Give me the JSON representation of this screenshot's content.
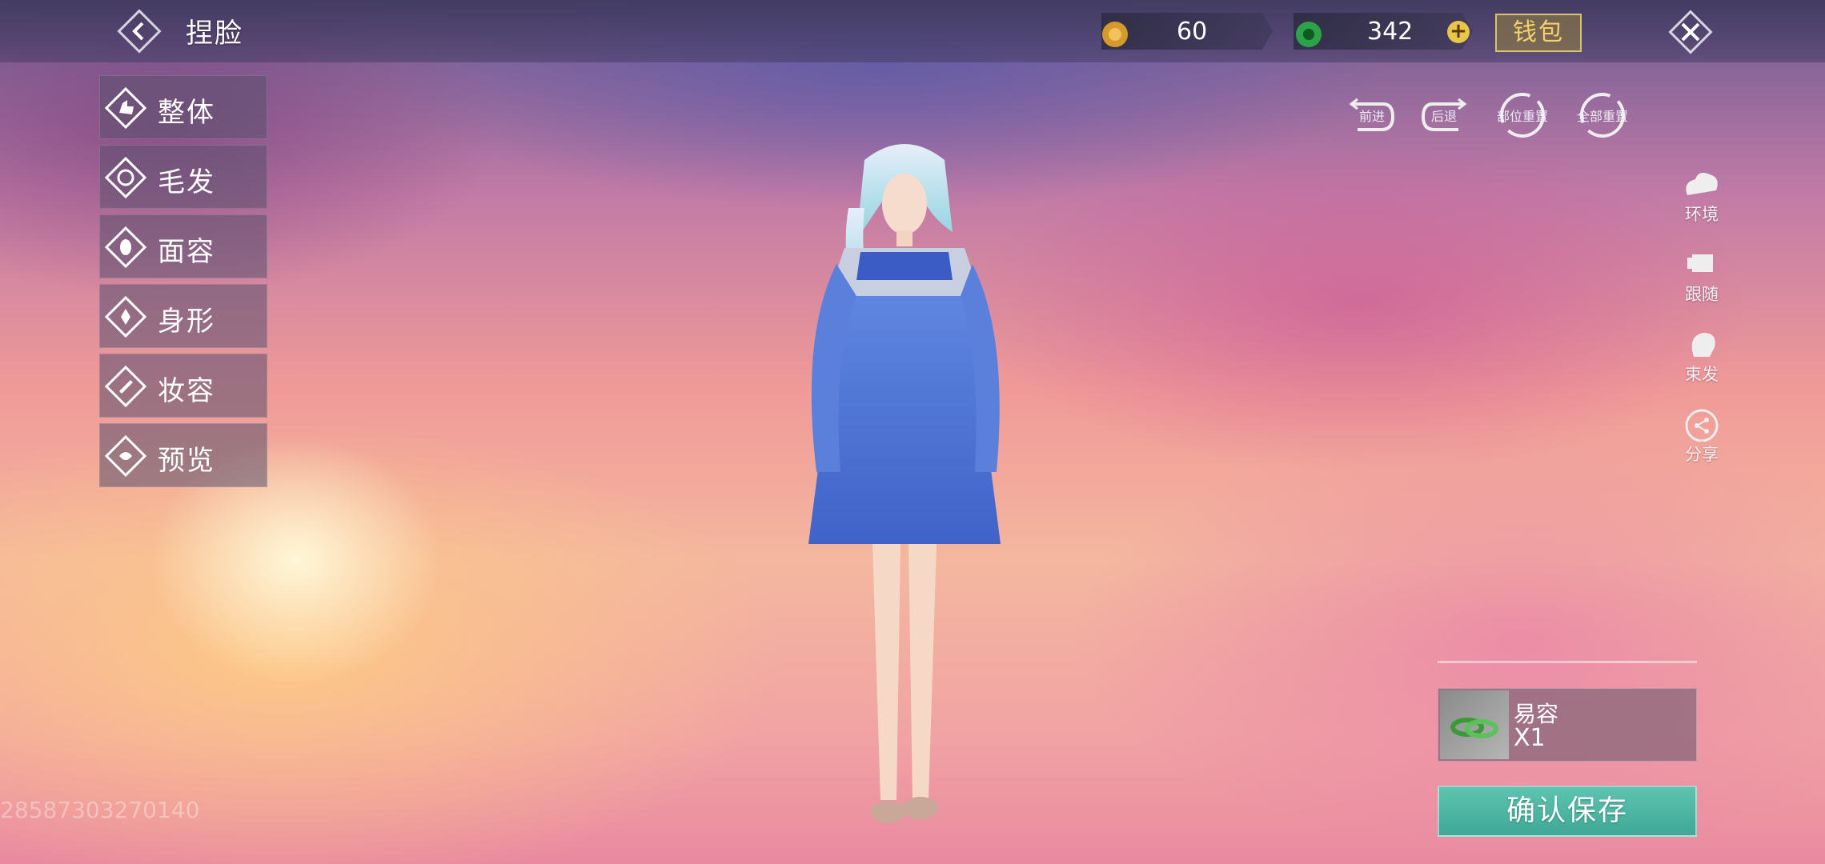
{
  "header": {
    "title": "捏脸",
    "currencies": [
      {
        "icon": "gold-coin-icon",
        "value": "60"
      },
      {
        "icon": "jade-coin-icon",
        "value": "342"
      }
    ],
    "wallet_label": "钱包"
  },
  "left_menu": [
    {
      "label": "整体",
      "icon": "thumbs-up-icon"
    },
    {
      "label": "毛发",
      "icon": "hair-icon"
    },
    {
      "label": "面容",
      "icon": "face-icon"
    },
    {
      "label": "身形",
      "icon": "body-icon"
    },
    {
      "label": "妆容",
      "icon": "makeup-icon"
    },
    {
      "label": "预览",
      "icon": "preview-icon"
    }
  ],
  "toolbar": {
    "forward": "前进",
    "back": "后退",
    "reset_part": "部位重置",
    "reset_all": "全部重置"
  },
  "side_menu": [
    {
      "label": "环境"
    },
    {
      "label": "跟随"
    },
    {
      "label": "束发"
    },
    {
      "label": "分享"
    }
  ],
  "item": {
    "name": "易容",
    "qty": "X1"
  },
  "save_label": "确认保存",
  "uid": "28587303270140",
  "colors": {
    "accent": "#4fb8a4",
    "wallet": "#d9c36b"
  }
}
